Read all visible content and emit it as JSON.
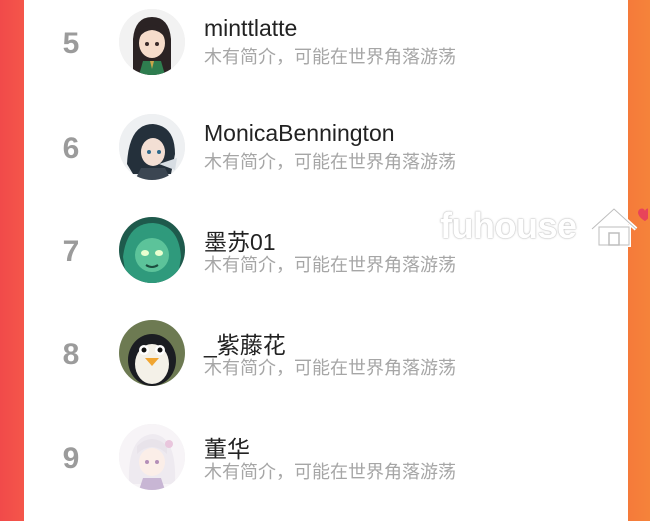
{
  "ranking": [
    {
      "rank": "5",
      "name": "minttlatte",
      "bio": "木有简介，可能在世界角落游荡",
      "avatar": "anime-girl-dark-hair-avatar"
    },
    {
      "rank": "6",
      "name": "MonicaBennington",
      "bio": "木有简介，可能在世界角落游荡",
      "avatar": "anime-boy-dark-hair-avatar"
    },
    {
      "rank": "7",
      "name": "墨苏01",
      "bio": "木有简介，可能在世界角落游荡",
      "avatar": "green-character-avatar"
    },
    {
      "rank": "8",
      "name": "_紫藤花",
      "bio": "木有简介，可能在世界角落游荡",
      "avatar": "penguin-avatar"
    },
    {
      "rank": "9",
      "name": "董华",
      "bio": "木有简介，可能在世界角落游荡",
      "avatar": "white-hair-anime-girl-avatar"
    }
  ],
  "watermark": {
    "text": "fuhouse"
  },
  "colors": {
    "left_edge": "#f14a4a",
    "right_edge": "#f5833a",
    "rank": "#9b9b9b",
    "name": "#222222",
    "bio": "#a6a6a6"
  }
}
